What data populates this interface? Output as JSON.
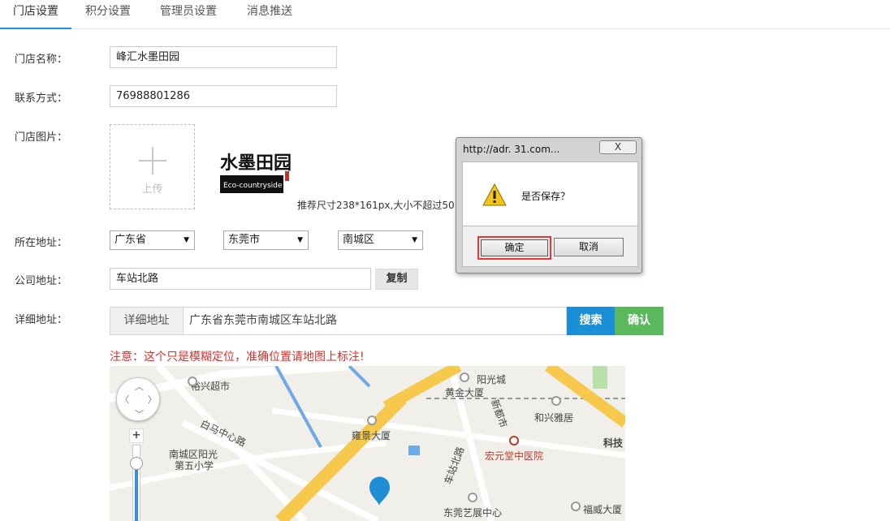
{
  "tabs": [
    {
      "label": "门店设置",
      "active": true
    },
    {
      "label": "积分设置",
      "active": false
    },
    {
      "label": "管理员设置",
      "active": false
    },
    {
      "label": "消息推送",
      "active": false
    }
  ],
  "form": {
    "store_name": {
      "label": "门店名称：",
      "value": "峰汇水墨田园"
    },
    "contact": {
      "label": "联系方式：",
      "value": "76988801286"
    },
    "image": {
      "label": "门店图片：",
      "upload_label": "上传",
      "thumb_text": "水墨田园",
      "thumb_subtext": "Eco-countryside",
      "hint": "推荐尺寸238*161px,大小不超过50"
    },
    "location": {
      "label": "所在地址：",
      "province": "广东省",
      "city": "东莞市",
      "district": "南城区"
    },
    "company_address": {
      "label": "公司地址：",
      "value": "车站北路",
      "copy_label": "复制"
    },
    "detail_address": {
      "label": "详细地址：",
      "prefix": "详细地址",
      "value": "广东省东莞市南城区车站北路",
      "search_label": "搜索",
      "confirm_label": "确认"
    },
    "notice": "注意：这个只是模糊定位，准确位置请地图上标注!"
  },
  "map": {
    "labels": [
      "裕兴超市",
      "阳光城",
      "黄金大厦",
      "和兴雅居",
      "白马中心路",
      "南城区阳光",
      "第五小学",
      "雍景大厦",
      "宏元堂中医院",
      "科技",
      "东莞艺展中心",
      "福威大厦",
      "车站北路",
      "新都市"
    ],
    "zoom_plus": "+"
  },
  "dialog": {
    "title": "http://adr.                31.com...",
    "close_label": "X",
    "message": "是否保存？",
    "ok_label": "确定",
    "cancel_label": "取消"
  }
}
